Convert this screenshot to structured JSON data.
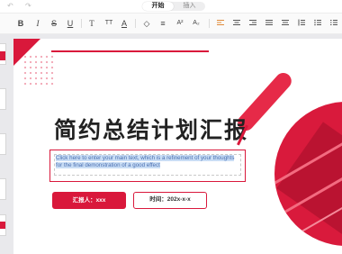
{
  "nav": {
    "undo_icon": "↶",
    "redo_icon": "↷"
  },
  "tabs": [
    {
      "label": "开始",
      "active": true
    },
    {
      "label": "插入",
      "active": false
    }
  ],
  "toolbar": {
    "bold": "B",
    "italic": "I",
    "strike": "S",
    "underline": "U",
    "text_style": "T",
    "text_height": "TT",
    "font_color": "A",
    "fill": "◇",
    "erase": "≡",
    "superscript": "A²",
    "subscript": "A₂"
  },
  "slide": {
    "title": "简约总结计划汇报",
    "body_text": "Click here to enter your main text, which is a refinement of your thoughts for the final demonstration of a good effect",
    "reporter_label": "汇报人：xxx",
    "time_label": "时间：202x-x-x"
  },
  "colors": {
    "accent": "#d9183b",
    "highlight": "#c9ddf5",
    "text_blue": "#4a6fb0"
  }
}
